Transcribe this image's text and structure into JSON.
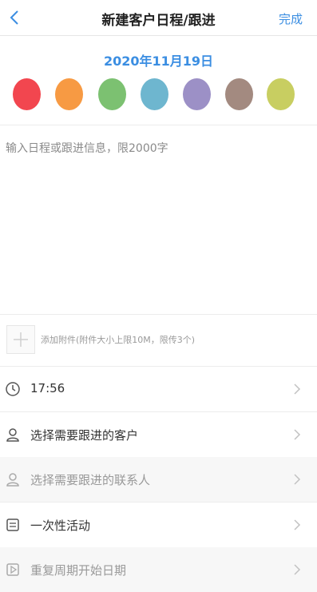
{
  "header": {
    "title": "新建客户日程/跟进",
    "done_label": "完成"
  },
  "date_text": "2020年11月19日",
  "color_options": [
    "#f2464f",
    "#f79a43",
    "#7cc171",
    "#6eb6cf",
    "#9c90c6",
    "#a38a80",
    "#c8ce61"
  ],
  "editor": {
    "placeholder": "输入日程或跟进信息，限2000字",
    "value": ""
  },
  "attachment": {
    "hint": "添加附件(附件大小上限10M，限传3个)"
  },
  "rows": [
    {
      "label": "17:56",
      "icon": "clock-icon"
    },
    {
      "label": "选择需要跟进的客户",
      "icon": "person-icon"
    },
    {
      "label": "选择需要跟进的联系人",
      "icon": "person-icon"
    },
    {
      "label": "一次性活动",
      "icon": "calendar-icon"
    },
    {
      "label": "重复周期开始日期",
      "icon": "play-icon"
    }
  ]
}
